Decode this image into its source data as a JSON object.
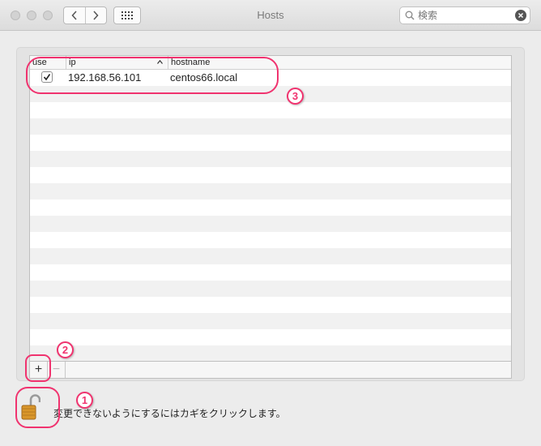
{
  "window": {
    "title": "Hosts",
    "search_placeholder": "検索"
  },
  "table": {
    "columns": {
      "use": "use",
      "ip": "ip",
      "hostname": "hostname"
    },
    "sort_indicator": "^",
    "rows": [
      {
        "use": true,
        "ip": "192.168.56.101",
        "hostname": "centos66.local"
      }
    ],
    "empty_row_count": 17
  },
  "toolbar": {
    "add_label": "+",
    "remove_label": "−"
  },
  "lock": {
    "message": "変更できないようにするにはカギをクリックします。",
    "state": "unlocked"
  },
  "annotations": {
    "one": "1",
    "two": "2",
    "three": "3",
    "color": "#f0336f"
  }
}
